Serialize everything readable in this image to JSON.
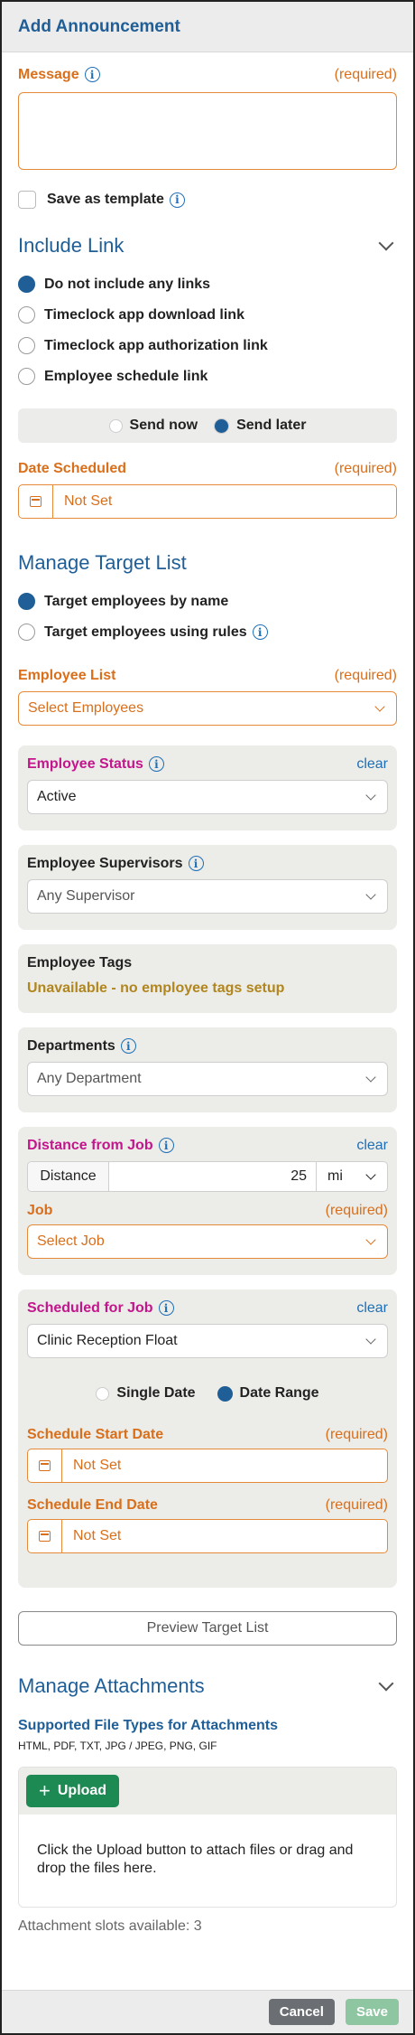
{
  "title": "Add Announcement",
  "message": {
    "label": "Message",
    "required": "(required)",
    "value": ""
  },
  "save_template": {
    "label": "Save as template"
  },
  "include_link": {
    "title": "Include Link",
    "options": [
      "Do not include any links",
      "Timeclock app download link",
      "Timeclock app authorization link",
      "Employee schedule link"
    ],
    "selected": 0
  },
  "send": {
    "now": "Send now",
    "later": "Send later",
    "selected": "later"
  },
  "date_scheduled": {
    "label": "Date Scheduled",
    "required": "(required)",
    "value": "Not Set"
  },
  "target": {
    "title": "Manage Target List",
    "by_name": "Target employees by name",
    "by_rules": "Target employees using rules",
    "selected": "by_name"
  },
  "employee_list": {
    "label": "Employee List",
    "required": "(required)",
    "placeholder": "Select Employees"
  },
  "employee_status": {
    "label": "Employee Status",
    "clear": "clear",
    "value": "Active"
  },
  "employee_supervisors": {
    "label": "Employee Supervisors",
    "value": "Any Supervisor"
  },
  "employee_tags": {
    "label": "Employee Tags",
    "message": "Unavailable - no employee tags setup"
  },
  "departments": {
    "label": "Departments",
    "value": "Any Department"
  },
  "distance": {
    "label": "Distance from Job",
    "clear": "clear",
    "field_label": "Distance",
    "value": "25",
    "unit": "mi",
    "job_label": "Job",
    "job_required": "(required)",
    "job_placeholder": "Select Job"
  },
  "scheduled": {
    "label": "Scheduled for Job",
    "clear": "clear",
    "value": "Clinic Reception Float",
    "single": "Single Date",
    "range": "Date Range",
    "selected": "range",
    "start_label": "Schedule Start Date",
    "start_required": "(required)",
    "start_value": "Not Set",
    "end_label": "Schedule End Date",
    "end_required": "(required)",
    "end_value": "Not Set"
  },
  "preview": {
    "label": "Preview Target List"
  },
  "attachments": {
    "title": "Manage Attachments",
    "types_title": "Supported File Types for Attachments",
    "types": "HTML, PDF, TXT, JPG / JPEG, PNG, GIF",
    "upload": "Upload",
    "drop_text": "Click the Upload button to attach files or drag and drop the files here.",
    "slots": "Attachment slots available: 3"
  },
  "footer": {
    "cancel": "Cancel",
    "save": "Save"
  },
  "colors": {
    "blue": "#1f5e96",
    "orange": "#d96f1b",
    "magenta": "#c3158c",
    "green": "#1c8a52"
  }
}
